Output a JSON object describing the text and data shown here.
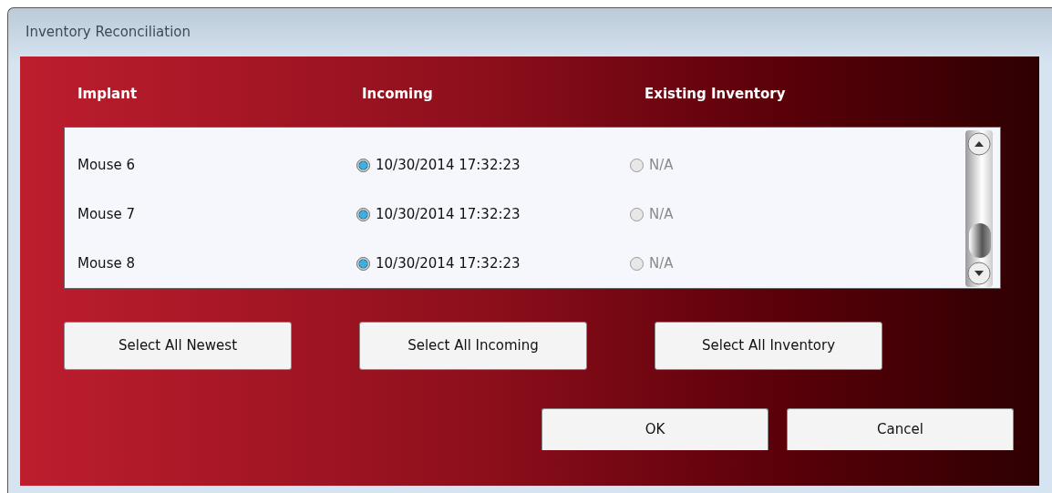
{
  "window": {
    "title": "Inventory Reconciliation"
  },
  "columns": [
    "Implant",
    "Incoming",
    "Existing Inventory"
  ],
  "rows": [
    {
      "implant": "Mouse 6",
      "incoming": {
        "label": "10/30/2014 17:32:23",
        "selected": true,
        "disabled": false
      },
      "existing": {
        "label": "N/A",
        "selected": false,
        "disabled": true
      }
    },
    {
      "implant": "Mouse 7",
      "incoming": {
        "label": "10/30/2014 17:32:23",
        "selected": true,
        "disabled": false
      },
      "existing": {
        "label": "N/A",
        "selected": false,
        "disabled": true
      }
    },
    {
      "implant": "Mouse 8",
      "incoming": {
        "label": "10/30/2014 17:32:23",
        "selected": true,
        "disabled": false
      },
      "existing": {
        "label": "N/A",
        "selected": false,
        "disabled": true
      }
    }
  ],
  "select_buttons": [
    "Select All Newest",
    "Select All Incoming",
    "Select All Inventory"
  ],
  "dialog_buttons": [
    "OK",
    "Cancel"
  ]
}
